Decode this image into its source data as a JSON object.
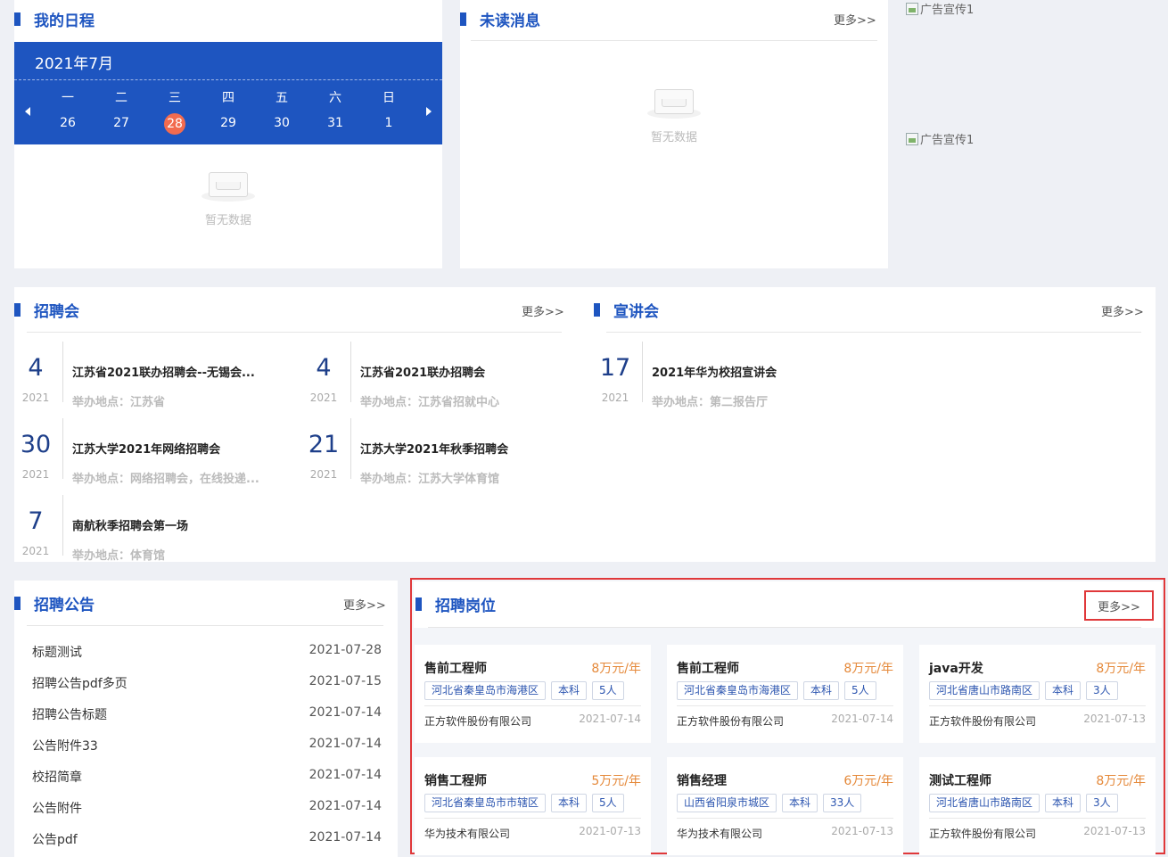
{
  "schedule": {
    "title": "我的日程",
    "month": "2021年7月",
    "weekdays": [
      "一",
      "二",
      "三",
      "四",
      "五",
      "六",
      "日"
    ],
    "days": [
      "26",
      "27",
      "28",
      "29",
      "30",
      "31",
      "1"
    ],
    "today": "28",
    "empty_text": "暂无数据"
  },
  "messages": {
    "title": "未读消息",
    "more": "更多>>",
    "empty_text": "暂无数据"
  },
  "ads": [
    "广告宣传1",
    "广告宣传1"
  ],
  "job_fairs": {
    "title": "招聘会",
    "more": "更多>>",
    "items": [
      {
        "day": "4",
        "year": "2021",
        "name": "江苏省2021联办招聘会--无锡会...",
        "location": "举办地点：江苏省"
      },
      {
        "day": "4",
        "year": "2021",
        "name": "江苏省2021联办招聘会",
        "location": "举办地点：江苏省招就中心"
      },
      {
        "day": "30",
        "year": "2021",
        "name": "江苏大学2021年网络招聘会",
        "location": "举办地点：网络招聘会，在线投递..."
      },
      {
        "day": "21",
        "year": "2021",
        "name": "江苏大学2021年秋季招聘会",
        "location": "举办地点：江苏大学体育馆"
      },
      {
        "day": "7",
        "year": "2021",
        "name": "南航秋季招聘会第一场",
        "location": "举办地点：体育馆"
      }
    ]
  },
  "seminars": {
    "title": "宣讲会",
    "more": "更多>>",
    "items": [
      {
        "day": "17",
        "year": "2021",
        "name": "2021年华为校招宣讲会",
        "location": "举办地点：第二报告厅"
      }
    ]
  },
  "announcements": {
    "title": "招聘公告",
    "more": "更多>>",
    "items": [
      {
        "title": "标题测试",
        "date": "2021-07-28"
      },
      {
        "title": "招聘公告pdf多页",
        "date": "2021-07-15"
      },
      {
        "title": "招聘公告标题",
        "date": "2021-07-14"
      },
      {
        "title": "公告附件33",
        "date": "2021-07-14"
      },
      {
        "title": "校招简章",
        "date": "2021-07-14"
      },
      {
        "title": "公告附件",
        "date": "2021-07-14"
      },
      {
        "title": "公告pdf",
        "date": "2021-07-14"
      }
    ]
  },
  "positions": {
    "title": "招聘岗位",
    "more": "更多>>",
    "highlight_color": "#e0383a",
    "items": [
      {
        "title": "售前工程师",
        "salary": "8万元/年",
        "area": "河北省秦皇岛市海港区",
        "degree": "本科",
        "count": "5人",
        "company": "正方软件股份有限公司",
        "date": "2021-07-14"
      },
      {
        "title": "售前工程师",
        "salary": "8万元/年",
        "area": "河北省秦皇岛市海港区",
        "degree": "本科",
        "count": "5人",
        "company": "正方软件股份有限公司",
        "date": "2021-07-14"
      },
      {
        "title": "java开发",
        "salary": "8万元/年",
        "area": "河北省唐山市路南区",
        "degree": "本科",
        "count": "3人",
        "company": "正方软件股份有限公司",
        "date": "2021-07-13"
      },
      {
        "title": "销售工程师",
        "salary": "5万元/年",
        "area": "河北省秦皇岛市市辖区",
        "degree": "本科",
        "count": "5人",
        "company": "华为技术有限公司",
        "date": "2021-07-13"
      },
      {
        "title": "销售经理",
        "salary": "6万元/年",
        "area": "山西省阳泉市城区",
        "degree": "本科",
        "count": "33人",
        "company": "华为技术有限公司",
        "date": "2021-07-13"
      },
      {
        "title": "测试工程师",
        "salary": "8万元/年",
        "area": "河北省唐山市路南区",
        "degree": "本科",
        "count": "3人",
        "company": "正方软件股份有限公司",
        "date": "2021-07-13"
      }
    ]
  },
  "colors": {
    "brand": "#1e55c0",
    "today": "#f26b4f",
    "salary": "#e5893a"
  }
}
